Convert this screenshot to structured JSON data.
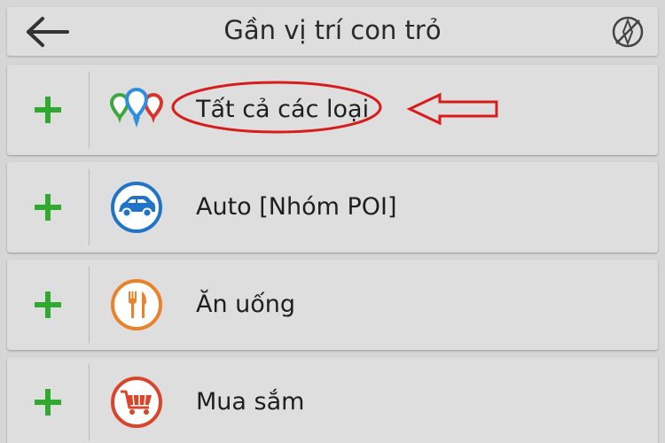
{
  "header": {
    "title": "Gần vị trí con trỏ",
    "back_icon": "arrow-left-icon",
    "right_icon": "no-compass-icon"
  },
  "rows": [
    {
      "label": "Tất cả các loại",
      "icon": "multi-pin-icon"
    },
    {
      "label": "Auto [Nhóm POI]",
      "icon": "car-icon"
    },
    {
      "label": "Ăn uống",
      "icon": "fork-knife-icon"
    },
    {
      "label": "Mua sắm",
      "icon": "shopping-cart-icon"
    }
  ],
  "colors": {
    "plus": "#2eaa2e",
    "annotation": "#d81c1c",
    "car_blue": "#1f74c9",
    "food_orange": "#e9822b",
    "shop_red": "#d9442a"
  }
}
